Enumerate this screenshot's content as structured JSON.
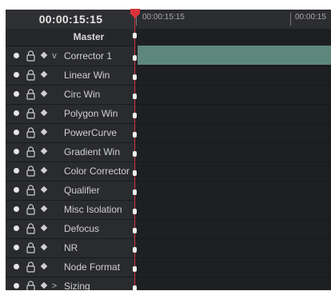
{
  "timecode": "00:00:15:15",
  "ruler": {
    "tc_primary": "00:00:15:15",
    "tc_secondary": "00:00:15"
  },
  "master_label": "Master",
  "rows": [
    {
      "label": "Corrector 1",
      "expand": "v"
    },
    {
      "label": "Linear Win",
      "expand": ""
    },
    {
      "label": "Circ Win",
      "expand": ""
    },
    {
      "label": "Polygon Win",
      "expand": ""
    },
    {
      "label": "PowerCurve",
      "expand": ""
    },
    {
      "label": "Gradient Win",
      "expand": ""
    },
    {
      "label": "Color Corrector",
      "expand": ""
    },
    {
      "label": "Qualifier",
      "expand": ""
    },
    {
      "label": "Misc Isolation",
      "expand": ""
    },
    {
      "label": "Defocus",
      "expand": ""
    },
    {
      "label": "NR",
      "expand": ""
    },
    {
      "label": "Node Format",
      "expand": ""
    },
    {
      "label": "Sizing",
      "expand": ">"
    }
  ],
  "colors": {
    "playhead": "#c8333a",
    "clip": "#5e877b"
  }
}
